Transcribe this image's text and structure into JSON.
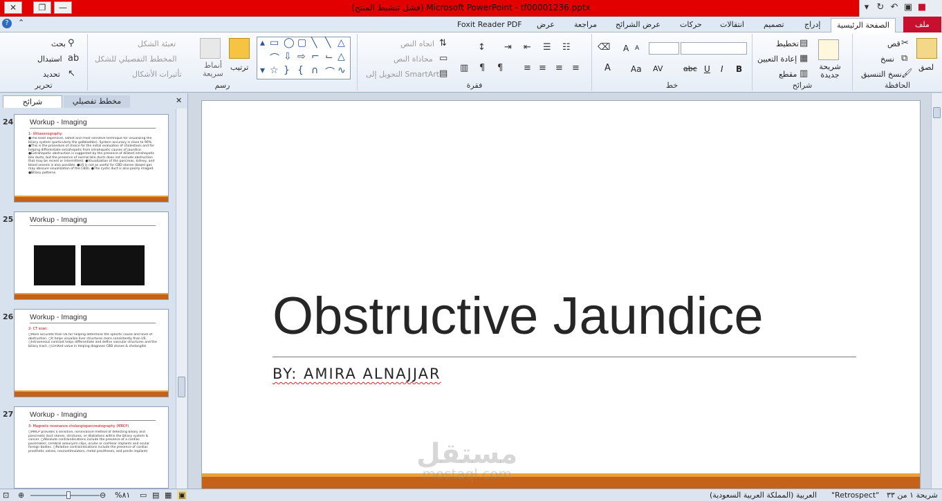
{
  "titlebar": {
    "title": "(فشل تنشيط المنتج) Microsoft PowerPoint - tf00001236.pptx",
    "close_glyph": "✕",
    "restore_glyph": "❐",
    "minimize_glyph": "—"
  },
  "tabs": {
    "file": "ملف",
    "home": "الصفحة الرئيسية",
    "insert": "إدراج",
    "design": "تصميم",
    "transitions": "انتقالات",
    "animations": "حركات",
    "slideshow": "عرض الشرائح",
    "review": "مراجعة",
    "view": "عرض",
    "foxit": "Foxit Reader PDF"
  },
  "ribbon": {
    "clipboard": {
      "label": "الحافظة",
      "paste": "لصق",
      "cut": "قص",
      "copy": "نسخ",
      "format_painter": "نسخ التنسيق"
    },
    "slides": {
      "label": "شرائح",
      "new_slide": "شريحة جديدة",
      "layout": "تخطيط",
      "reset": "إعادة التعيين",
      "section": "مقطع"
    },
    "font": {
      "label": "خط",
      "bold": "B",
      "italic": "I",
      "underline": "U",
      "strike": "abc",
      "spacing": "AV",
      "case": "Aa",
      "grow": "A",
      "shrink": "A"
    },
    "paragraph": {
      "label": "فقرة",
      "text_direction": "اتجاه النص",
      "align_text": "محاذاة النص",
      "smartart": "التحويل إلى SmartArt"
    },
    "drawing": {
      "label": "رسم",
      "arrange": "ترتيب",
      "quick_styles": "أنماط سريعة",
      "shape_fill": "تعبئة الشكل",
      "shape_outline": "المخطط التفصيلي للشكل",
      "shape_effects": "تأثيرات الأشكال"
    },
    "editing": {
      "label": "تحرير",
      "find": "بحث",
      "replace": "استبدال",
      "select": "تحديد"
    }
  },
  "panel": {
    "tab_slides": "شرائح",
    "tab_outline": "مخطط تفصيلي",
    "close_glyph": "✕",
    "thumbnails": [
      {
        "num": "24",
        "title": "Workup - Imaging",
        "subtitle": "1- Ultrasonography:",
        "text": "●The least expensive, safest and most sensitive technique for visualizing the biliary system (particularly the gallbladder). System accuracy is close to 90%. ●This is the procedure of choice for the initial evaluation of cholestasis and for helping differentiate extrahepatic from intrahepatic causes of jaundice. ●Extrahepatic obstruction is suggested by the presence of dilated intrahepatic bile ducts, but the presence of normal bile ducts does not exclude obstruction that may be recent or intermittent. ●Visualization of the pancreas, kidney, and blood vessels is also possible. ●US is not as useful for CBD stones (bowel gas may obscure visualization of the CBD). ●The cystic duct is also poorly imaged. ●Biliary patterns."
      },
      {
        "num": "25",
        "title": "Workup - Imaging",
        "subtitle": "",
        "text": ""
      },
      {
        "num": "26",
        "title": "Workup - Imaging",
        "subtitle": "2- CT scan:",
        "text": "○More accurate than US for helping determine the specific cause and level of obstruction. ○It helps visualize liver structures more consistently than US. ○Intravenous contrast helps differentiate and define vascular structures and the biliary tract. ○Limited value in helping diagnose CBD stones & cholangitis"
      },
      {
        "num": "27",
        "title": "Workup - Imaging",
        "subtitle": "3- Magnetic resonance cholangiopancreatography (MRCP)",
        "text": "○MRCP provides a sensitive, noninvasive method of detecting biliary and pancreatic duct stones, strictures, or dilatations within the biliary system & cancer. ○Absolute contraindications include the presence of a cardiac pacemaker, cerebral aneurysm clips, ocular or cochlear implants and ocular foreign bodies. ○Relative contraindications include the presence of cardiac prosthetic valves, neurostimulators, metal prostheses, and penile implants"
      }
    ]
  },
  "slide": {
    "title": "Obstructive Jaundice",
    "subtitle": "BY: AMIRA ALNAJJAR"
  },
  "watermark": {
    "arabic": "مستقل",
    "latin": "mostaql.com"
  },
  "statusbar": {
    "slide_info": "شريحة ١ من ٣٣",
    "theme": "\"Retrospect\"",
    "language": "العربية (المملكة العربية السعودية)",
    "zoom": "%٨١"
  },
  "colors": {
    "titlebar": "#e30000",
    "accent_band": "#c5621a",
    "accent_top": "#e9a23b",
    "file_tab": "#c8102e"
  }
}
